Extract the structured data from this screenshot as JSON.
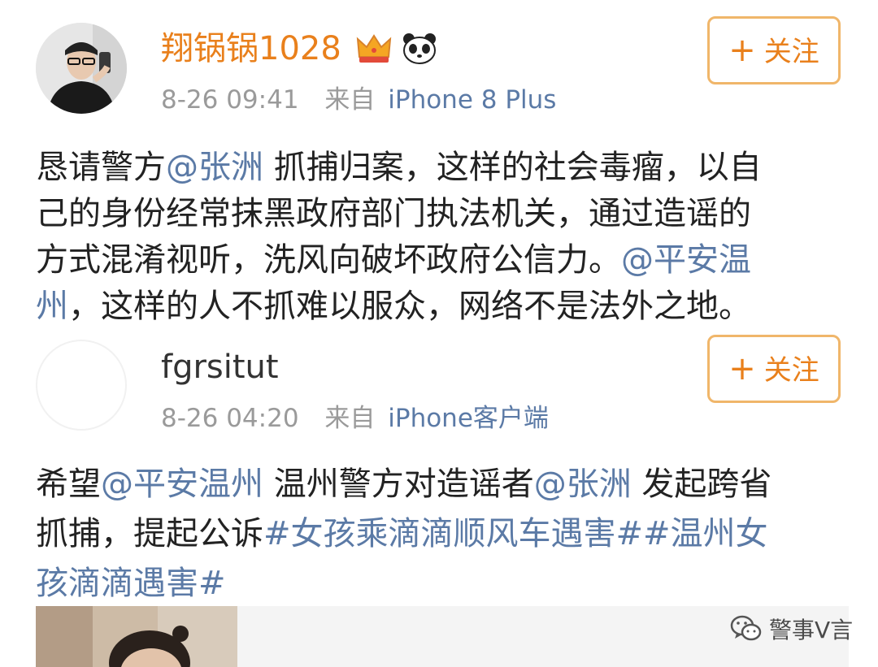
{
  "post1": {
    "username": "翔锅锅1028",
    "time": "8-26 09:41",
    "source_label": "来自",
    "device": "iPhone 8 Plus",
    "follow_plus": "+",
    "follow_label": "关注",
    "badges": [
      "crown-icon",
      "panda-icon"
    ],
    "lines": [
      [
        {
          "t": "恳请警方"
        },
        {
          "t": "@张洲",
          "link": true
        },
        {
          "t": " 抓捕归案，这样的社会毒瘤，以自"
        }
      ],
      [
        {
          "t": "己的身份经常抹黑政府部门执法机关，通过造谣的"
        }
      ],
      [
        {
          "t": "方式混淆视听，洗风向破坏政府公信力。"
        },
        {
          "t": "@平安温",
          "link": true
        }
      ],
      [
        {
          "t": "州",
          "link": true
        },
        {
          "t": "，这样的人不抓难以服众，网络不是法外之地。"
        }
      ]
    ]
  },
  "post2": {
    "username": "fgrsitut",
    "time": "8-26 04:20",
    "source_label": "来自",
    "device": "iPhone客户端",
    "follow_plus": "+",
    "follow_label": "关注",
    "lines": [
      [
        {
          "t": "希望"
        },
        {
          "t": "@平安温州",
          "link": true
        },
        {
          "t": " 温州警方对造谣者"
        },
        {
          "t": "@张洲",
          "link": true
        },
        {
          "t": " 发起跨省"
        }
      ],
      [
        {
          "t": "抓捕，提起公诉"
        },
        {
          "t": "#女孩乘滴滴顺风车遇害##温州女",
          "link": true
        }
      ],
      [
        {
          "t": "孩滴滴遇害#",
          "link": true
        }
      ]
    ]
  },
  "watermark": {
    "label": "警事V言",
    "icon": "wechat-icon"
  },
  "colors": {
    "accent": "#e9801c",
    "link": "#5b7aa6",
    "meta": "#9a9a9a",
    "text": "#222222",
    "button_border": "#f0b66a"
  }
}
